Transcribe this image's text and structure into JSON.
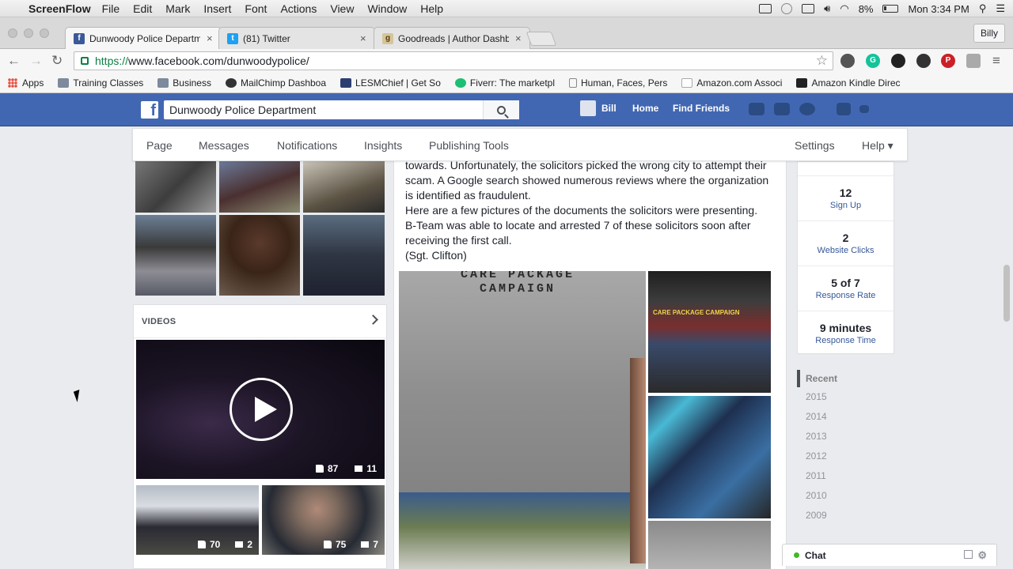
{
  "mac": {
    "app_name": "ScreenFlow",
    "menus": [
      "File",
      "Edit",
      "Mark",
      "Insert",
      "Font",
      "Actions",
      "View",
      "Window",
      "Help"
    ],
    "battery": "8%",
    "clock": "Mon 3:34 PM"
  },
  "browser": {
    "tabs": [
      {
        "title": "Dunwoody Police Departm"
      },
      {
        "title": "(81) Twitter"
      },
      {
        "title": "Goodreads | Author Dashb"
      }
    ],
    "profile": "Billy",
    "url_scheme": "https://",
    "url_rest": "www.facebook.com/dunwoodypolice/",
    "bookmarks": [
      "Apps",
      "Training Classes",
      "Business",
      "MailChimp Dashboa",
      "LESMChief | Get So",
      "Fiverr: The marketpl",
      "Human, Faces, Pers",
      "Amazon.com Associ",
      "Amazon Kindle Direc"
    ]
  },
  "fb": {
    "search_value": "Dunwoody Police Department",
    "user": "Bill",
    "nav_home": "Home",
    "nav_find_friends": "Find Friends"
  },
  "page_tabs": {
    "page": "Page",
    "messages": "Messages",
    "notifications": "Notifications",
    "insights": "Insights",
    "publishing_tools": "Publishing Tools",
    "settings": "Settings",
    "help": "Help ▾"
  },
  "videos": {
    "header": "VIDEOS",
    "main": {
      "likes": "87",
      "comments": "11"
    },
    "small": [
      {
        "likes": "70",
        "comments": "2"
      },
      {
        "likes": "75",
        "comments": "7"
      }
    ]
  },
  "post": {
    "lines": [
      "towards. Unfortunately, the solicitors picked the wrong city to attempt their",
      "scam. A Google search showed numerous reviews where the organization",
      "is identified as fraudulent.",
      "Here are a few pictures of the documents the solicitors were presenting.",
      "B-Team was able to locate and arrested 7 of these solicitors soon after",
      "receiving the first call.",
      "(Sgt. Clifton)"
    ],
    "doc_title_1": "CARE PACKAGE",
    "doc_title_2": "CAMPAIGN",
    "thumb_banner": "CARE PACKAGE CAMPAIGN"
  },
  "stats": [
    {
      "value": "12",
      "label": "Sign Up"
    },
    {
      "value": "2",
      "label": "Website Clicks"
    },
    {
      "value": "5 of 7",
      "label": "Response Rate"
    },
    {
      "value": "9 minutes",
      "label": "Response Time"
    }
  ],
  "years": {
    "recent": "Recent",
    "list": [
      "2015",
      "2014",
      "2013",
      "2012",
      "2011",
      "2010",
      "2009"
    ]
  },
  "chat": {
    "label": "Chat"
  }
}
